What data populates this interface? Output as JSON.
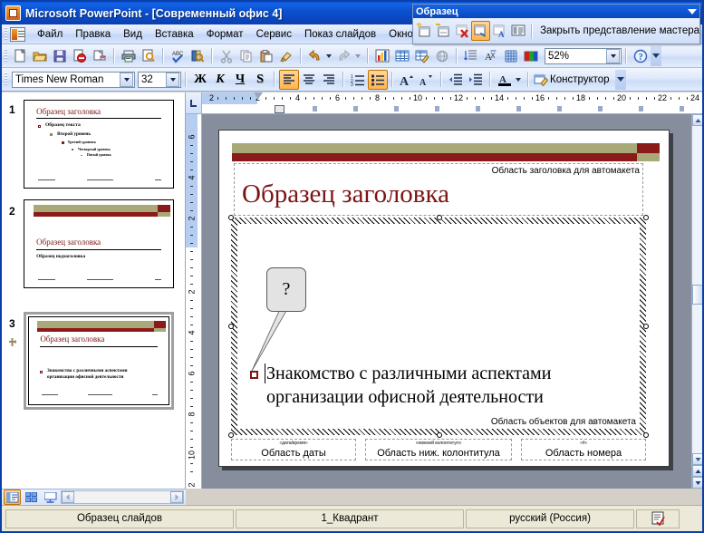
{
  "window": {
    "title": "Microsoft PowerPoint - [Современный офис 4]",
    "app_icon": "powerpoint-icon"
  },
  "menu": {
    "items": [
      {
        "label": "Файл"
      },
      {
        "label": "Правка"
      },
      {
        "label": "Вид"
      },
      {
        "label": "Вставка"
      },
      {
        "label": "Формат"
      },
      {
        "label": "Сервис"
      },
      {
        "label": "Показ слайдов"
      },
      {
        "label": "Окно"
      }
    ]
  },
  "standard_toolbar": {
    "buttons": [
      {
        "name": "new-icon"
      },
      {
        "name": "open-icon"
      },
      {
        "name": "save-icon"
      },
      {
        "name": "permission-icon"
      },
      {
        "name": "email-icon"
      },
      {
        "name": "print-icon"
      },
      {
        "name": "print-preview-icon"
      },
      {
        "name": "spelling-icon"
      },
      {
        "name": "research-icon"
      },
      {
        "name": "cut-icon"
      },
      {
        "name": "copy-icon"
      },
      {
        "name": "paste-icon"
      },
      {
        "name": "format-painter-icon"
      },
      {
        "name": "undo-icon"
      },
      {
        "name": "redo-icon"
      },
      {
        "name": "insert-chart-icon"
      },
      {
        "name": "insert-table-icon"
      },
      {
        "name": "table-draw-icon"
      },
      {
        "name": "hyperlink-icon"
      },
      {
        "name": "expand-all-icon"
      },
      {
        "name": "show-formatting-icon"
      },
      {
        "name": "grid-icon"
      },
      {
        "name": "color-scheme-icon"
      }
    ],
    "zoom_value": "52%",
    "help_icon": "help-icon"
  },
  "formatting_toolbar": {
    "font_name": "Times New Roman",
    "font_size": "32",
    "bold_label": "Ж",
    "italic_label": "К",
    "underline_label": "Ч",
    "shadow_label": "S",
    "align_left": "align-left-icon",
    "align_center": "align-center-icon",
    "align_right": "align-right-icon",
    "numbering": "numbered-list-icon",
    "bullets": "bulleted-list-icon",
    "font_grow": "increase-font-icon",
    "font_shrink": "decrease-font-icon",
    "decrease_indent": "decrease-indent-icon",
    "increase_indent": "increase-indent-icon",
    "font_color": "font-color-icon",
    "design_label": "Конструктор"
  },
  "master_toolbar": {
    "title": "Образец",
    "close_label": "Закрыть представление мастера",
    "buttons": [
      {
        "name": "insert-new-master-icon"
      },
      {
        "name": "insert-new-layout-icon"
      },
      {
        "name": "delete-master-icon"
      },
      {
        "name": "preserve-master-icon"
      },
      {
        "name": "rename-master-icon"
      },
      {
        "name": "master-layout-icon"
      }
    ]
  },
  "slides_pane": {
    "thumbnails": [
      {
        "number": "1",
        "selected": false,
        "title": "Образец заголовка",
        "lines": [
          "Образец текста",
          "Второй уровень",
          "Третий уровень",
          "Четвертый уровень",
          "Пятый уровень"
        ]
      },
      {
        "number": "2",
        "selected": false,
        "title": "Образец заголовка",
        "lines": [
          "Образец подзаголовка"
        ]
      },
      {
        "number": "3",
        "selected": true,
        "title": "Образец заголовка",
        "lines": [
          "Знакомство с различными аспектами",
          "организации офисной деятельности"
        ]
      }
    ],
    "view_buttons": [
      {
        "name": "normal-view-icon",
        "selected": true
      },
      {
        "name": "slide-sorter-view-icon",
        "selected": false
      },
      {
        "name": "slide-show-view-icon",
        "selected": false
      }
    ]
  },
  "rulers": {
    "horizontal_numbers": [
      "2",
      "2",
      "4",
      "6",
      "8",
      "10",
      "12",
      "14",
      "16",
      "18",
      "20",
      "22",
      "24"
    ],
    "vertical_numbers": [
      "6",
      "4",
      "2",
      "2",
      "4",
      "6",
      "8",
      "10",
      "2"
    ]
  },
  "slide": {
    "title_placeholder_label": "Область заголовка для автомакета",
    "title_text": "Образец заголовка",
    "body_placeholder_label": "Область объектов для автомакета",
    "body_text_line1": "Знакомство с различными аспектами",
    "body_text_line2": "организации офисной деятельности",
    "callout_text": "?",
    "footers": [
      {
        "tag": "«дата/время»",
        "text": "Область даты"
      },
      {
        "tag": "«нижний колонтитул»",
        "text": "Область ниж. колонтитула"
      },
      {
        "tag": "«#»",
        "text": "Область номера"
      }
    ]
  },
  "status_bar": {
    "view_name": "Образец слайдов",
    "design_name": "1_Квадрант",
    "language": "русский (Россия)",
    "spellcheck_icon": "spellcheck-status-icon"
  }
}
